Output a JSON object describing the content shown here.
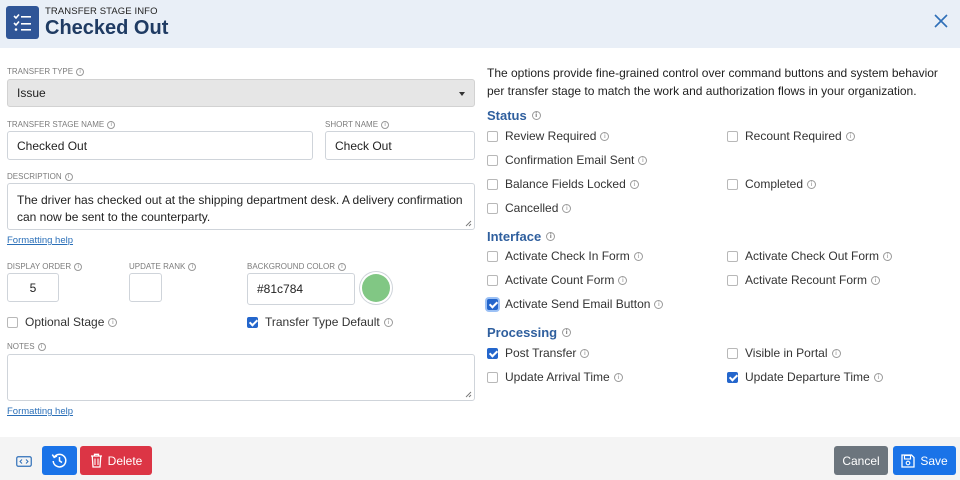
{
  "header": {
    "subtitle": "TRANSFER STAGE INFO",
    "title": "Checked Out"
  },
  "form": {
    "transfer_type_label": "TRANSFER TYPE",
    "transfer_type_value": "Issue",
    "stage_name_label": "TRANSFER STAGE NAME",
    "stage_name_value": "Checked Out",
    "short_name_label": "SHORT NAME",
    "short_name_value": "Check Out",
    "description_label": "DESCRIPTION",
    "description_value": "The driver has checked out at the shipping department desk. A delivery confirmation can now be sent to the counterparty.",
    "formatting_help": "Formatting help",
    "display_order_label": "DISPLAY ORDER",
    "display_order_value": "5",
    "update_rank_label": "UPDATE RANK",
    "update_rank_value": "",
    "background_color_label": "BACKGROUND COLOR",
    "background_color_value": "#81c784",
    "optional_stage_label": "Optional Stage",
    "optional_stage_checked": false,
    "transfer_type_default_label": "Transfer Type Default",
    "transfer_type_default_checked": true,
    "notes_label": "NOTES",
    "notes_value": ""
  },
  "options": {
    "intro": "The options provide fine-grained control over command buttons and system behavior per transfer stage to match the work and authorization flows in your organization.",
    "status_title": "Status",
    "status": [
      {
        "label": "Review Required",
        "checked": false
      },
      {
        "label": "Recount Required",
        "checked": false
      },
      {
        "label": "Confirmation Email Sent",
        "checked": false
      },
      {
        "label": "Balance Fields Locked",
        "checked": false
      },
      {
        "label": "Completed",
        "checked": false
      },
      {
        "label": "Cancelled",
        "checked": false
      }
    ],
    "interface_title": "Interface",
    "interface": [
      {
        "label": "Activate Check In Form",
        "checked": false
      },
      {
        "label": "Activate Check Out Form",
        "checked": false
      },
      {
        "label": "Activate Count Form",
        "checked": false
      },
      {
        "label": "Activate Recount Form",
        "checked": false
      },
      {
        "label": "Activate Send Email Button",
        "checked": true
      }
    ],
    "processing_title": "Processing",
    "processing": [
      {
        "label": "Post Transfer",
        "checked": true
      },
      {
        "label": "Visible in Portal",
        "checked": false
      },
      {
        "label": "Update Arrival Time",
        "checked": false
      },
      {
        "label": "Update Departure Time",
        "checked": true
      }
    ]
  },
  "footer": {
    "delete_label": "Delete",
    "cancel_label": "Cancel",
    "save_label": "Save"
  },
  "colors": {
    "header_bg": "#e9eff7",
    "primary": "#1a73e8",
    "danger": "#dc3545",
    "secondary": "#6c757d",
    "swatch": "#81c784"
  },
  "icons": {
    "header": "checklist-icon",
    "close": "close-icon",
    "info": "info-icon",
    "code": "code-icon",
    "history": "history-icon",
    "delete": "trash-icon",
    "save": "save-icon"
  }
}
